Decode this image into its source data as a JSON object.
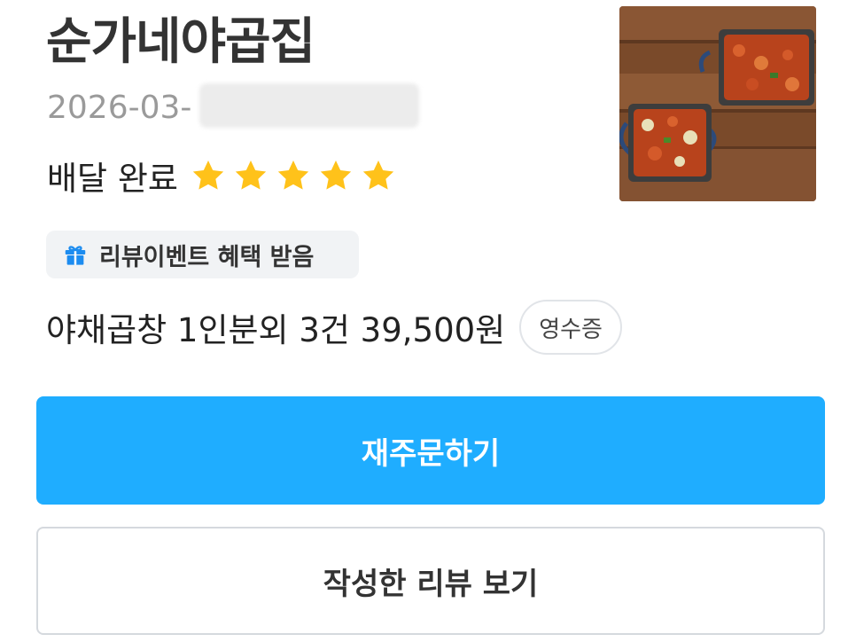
{
  "order": {
    "store_name": "순가네야곱집",
    "date_prefix": "2026-03-",
    "status": "배달 완료",
    "rating": 5,
    "event_badge": "리뷰이벤트 혜택 받음",
    "summary": "야채곱창 1인분외 3건 39,500원",
    "receipt_label": "영수증",
    "thumbnail_icon": "food-photo"
  },
  "actions": {
    "reorder_label": "재주문하기",
    "view_review_label": "작성한 리뷰 보기"
  },
  "colors": {
    "primary": "#1fadff",
    "star": "#ffc21a",
    "gift": "#1c8cf0"
  }
}
